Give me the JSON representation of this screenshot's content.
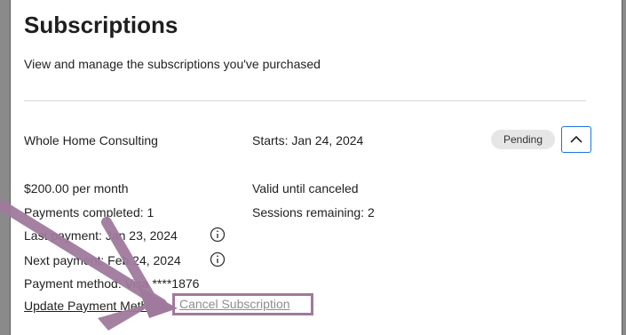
{
  "page": {
    "title": "Subscriptions",
    "subtitle": "View and manage the subscriptions you've purchased"
  },
  "subscription": {
    "name": "Whole Home Consulting",
    "starts": "Starts: Jan 24, 2024",
    "status": "Pending",
    "price": "$200.00 per month",
    "validity": "Valid until canceled",
    "payments_completed": "Payments completed: 1",
    "sessions_remaining": "Sessions remaining: 2",
    "last_payment": "Last payment: Jan 23, 2024",
    "next_payment": "Next payment: Feb 24, 2024",
    "payment_method": "Payment method: Visa ****1876",
    "update_payment_label": "Update Payment Method",
    "cancel_label": "Cancel Subscription"
  },
  "colors": {
    "highlight": "#a07a9c",
    "focus_border": "#1a73e8"
  },
  "icons": {
    "expand": "chevron-up-icon",
    "info": "info-icon",
    "annotation": "arrow-annotation"
  }
}
